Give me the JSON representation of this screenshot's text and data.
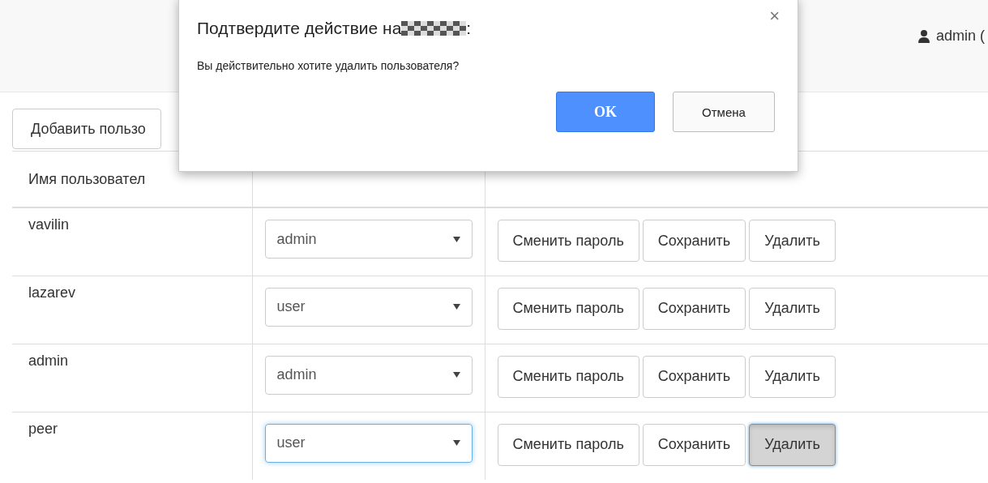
{
  "navbar": {
    "user": "admin ("
  },
  "add_button": "Добавить пользо",
  "table": {
    "columns": [
      "Имя пользовател"
    ],
    "rows": [
      {
        "name": "vavilin",
        "role": "admin",
        "focused": false,
        "actions": [
          {
            "label": "Сменить пароль",
            "pressed": false
          },
          {
            "label": "Сохранить",
            "pressed": false
          },
          {
            "label": "Удалить",
            "pressed": false
          }
        ]
      },
      {
        "name": "lazarev",
        "role": "user",
        "focused": false,
        "actions": [
          {
            "label": "Сменить пароль",
            "pressed": false
          },
          {
            "label": "Сохранить",
            "pressed": false
          },
          {
            "label": "Удалить",
            "pressed": false
          }
        ]
      },
      {
        "name": "admin",
        "role": "admin",
        "focused": false,
        "actions": [
          {
            "label": "Сменить пароль",
            "pressed": false
          },
          {
            "label": "Сохранить",
            "pressed": false
          },
          {
            "label": "Удалить",
            "pressed": false
          }
        ]
      },
      {
        "name": "peer",
        "role": "user",
        "focused": true,
        "actions": [
          {
            "label": "Сменить пароль",
            "pressed": false
          },
          {
            "label": "Сохранить",
            "pressed": false
          },
          {
            "label": "Удалить",
            "pressed": true
          }
        ]
      }
    ]
  },
  "dialog": {
    "title": "Подтвердите действие на",
    "title_end": ":",
    "close": "×",
    "message": "Вы действительно хотите удалить пользователя?",
    "buttons": [
      {
        "label": "OK",
        "kind": "primary"
      },
      {
        "label": "Отмена",
        "kind": "default"
      }
    ]
  }
}
